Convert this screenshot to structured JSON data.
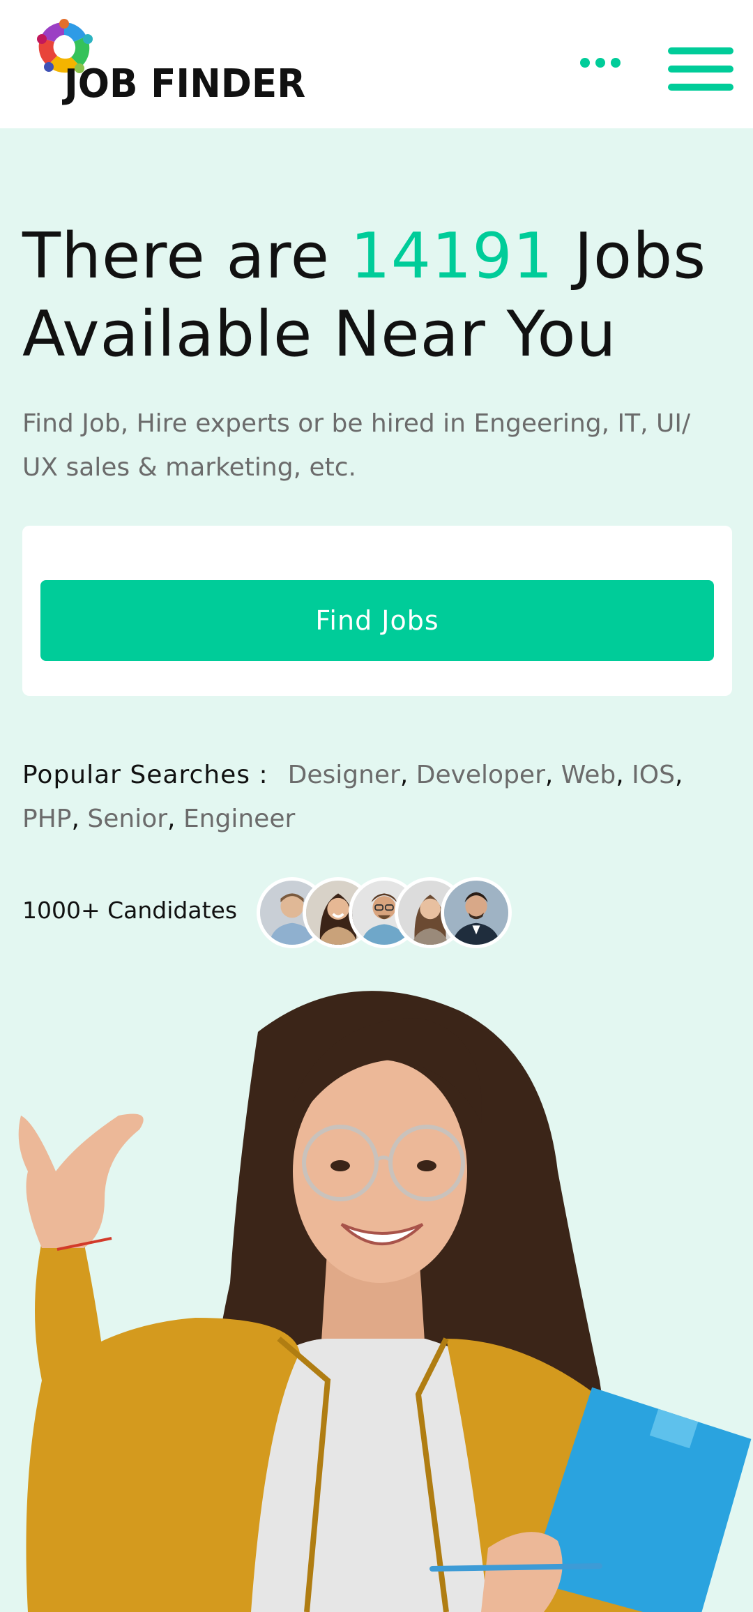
{
  "header": {
    "logo_text": "JOB FINDER",
    "logo_alt": "Job Finder logo",
    "more_label": "More options",
    "menu_label": "Menu"
  },
  "hero": {
    "title_before": "There are ",
    "job_count": "14191",
    "title_after": " Jobs Available Near You",
    "subtitle": "Find Job, Hire experts or be hired in Engeering, IT, UI/ UX sales & marketing, etc."
  },
  "search": {
    "button_label": "Find Jobs"
  },
  "popular": {
    "label": "Popular Searches :",
    "items": [
      "Designer",
      "Developer",
      "Web",
      "IOS",
      "PHP",
      "Senior",
      "Engineer"
    ]
  },
  "candidates": {
    "label": "1000+ Candidates"
  },
  "colors": {
    "accent": "#00cc99",
    "background": "#e3f7f1",
    "header_bg": "#ffffff",
    "text": "#111111",
    "muted": "#6b6b6b"
  },
  "icons": [
    "logo-icon",
    "more-dots-icon",
    "hamburger-menu-icon"
  ]
}
